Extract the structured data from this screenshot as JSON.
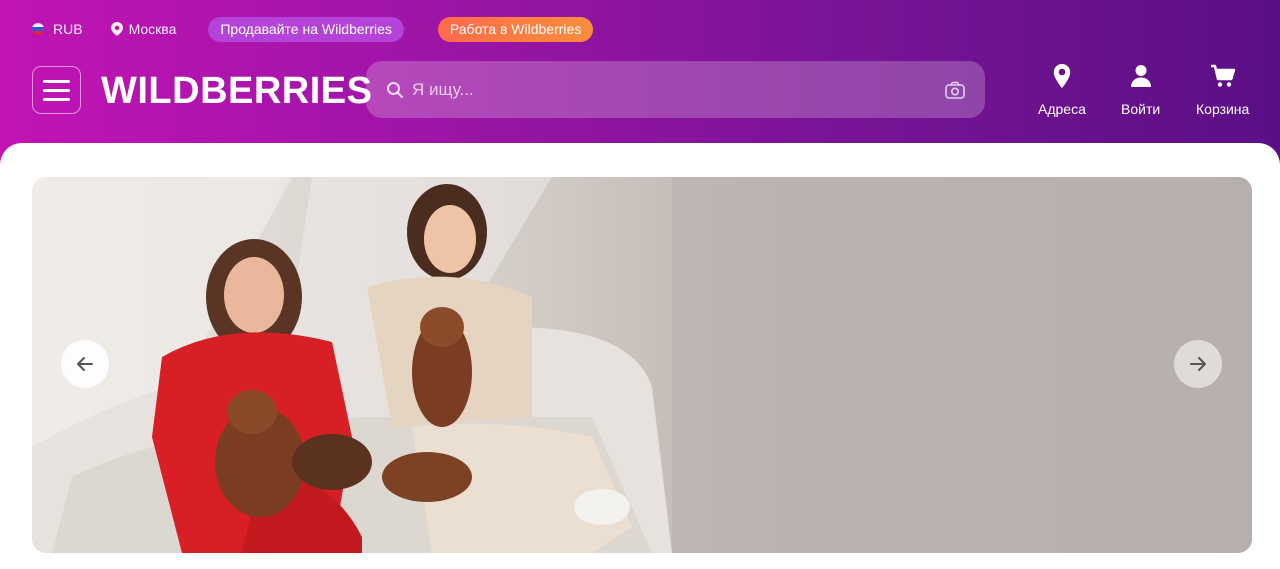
{
  "top_bar": {
    "currency": "RUB",
    "city": "Москва",
    "sell_label": "Продавайте на Wildberries",
    "work_label": "Работа в Wildberries"
  },
  "header": {
    "logo": "WILDBERRIES",
    "search_placeholder": "Я ищу..."
  },
  "nav": {
    "address": "Адреса",
    "login": "Войти",
    "cart": "Корзина"
  },
  "icons": [
    "flag-icon",
    "location-pin-icon",
    "burger-menu-icon",
    "search-icon",
    "camera-icon",
    "user-icon",
    "cart-icon",
    "arrow-left-icon",
    "arrow-right-icon"
  ],
  "colors": {
    "brand_gradient_start": "#c214b4",
    "brand_gradient_end": "#5a0f86",
    "sell_pill": "#b443d9",
    "work_pill": "#ff6a4b"
  }
}
